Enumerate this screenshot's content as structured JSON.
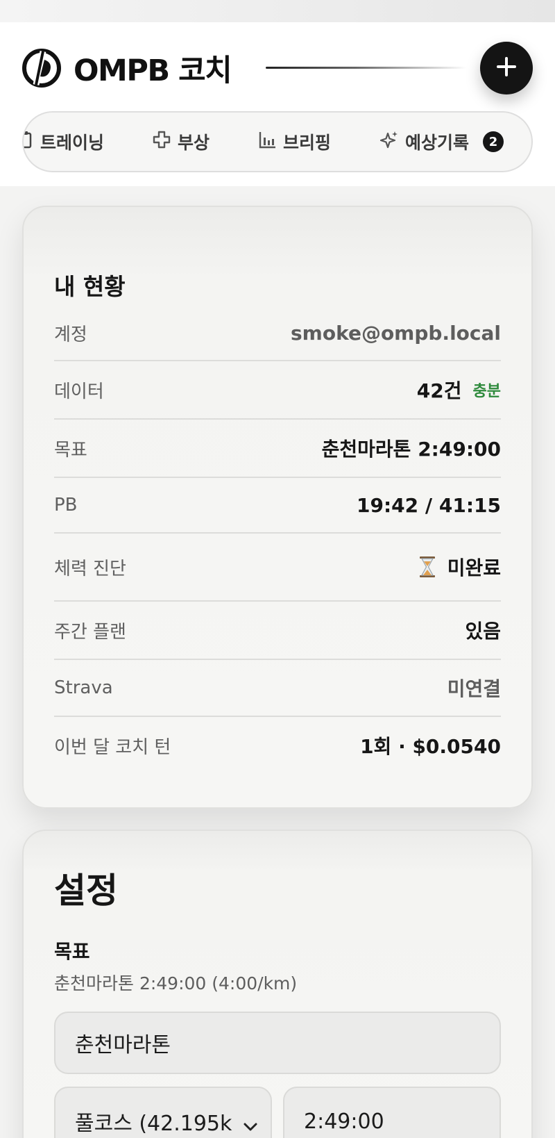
{
  "app": {
    "brand_name": "OMPB 코치"
  },
  "nav": {
    "tabs": [
      {
        "label": "트레이닝",
        "icon": "clipboard-icon"
      },
      {
        "label": "부상",
        "icon": "medical-cross-icon"
      },
      {
        "label": "브리핑",
        "icon": "bar-chart-icon"
      },
      {
        "label": "예상기록",
        "icon": "sparkle-icon",
        "badge": "2"
      }
    ]
  },
  "status": {
    "title": "내 현황",
    "rows": [
      {
        "label": "계정",
        "value": "smoke@ompb.local"
      },
      {
        "label": "데이터",
        "value": "42건",
        "tag": "충분"
      },
      {
        "label": "목표",
        "value": "춘천마라톤 2:49:00"
      },
      {
        "label": "PB",
        "value": "19:42 / 41:15"
      },
      {
        "label": "체력 진단",
        "value": "미완료",
        "icon": "hourglass-icon"
      },
      {
        "label": "주간 플랜",
        "value": "있음"
      },
      {
        "label": "Strava",
        "value": "미연결"
      },
      {
        "label": "이번 달 코치 턴",
        "value": "1회 · $0.0540"
      }
    ]
  },
  "settings": {
    "title": "설정",
    "goal_heading": "목표",
    "goal_summary": "춘천마라톤 2:49:00 (4:00/km)",
    "race_name_value": "춘천마라톤",
    "distance_value": "풀코스 (42.195k",
    "target_time_value": "2:49:00"
  },
  "colors": {
    "ok_green": "#2e8a3c",
    "fab_bg": "#141414"
  }
}
